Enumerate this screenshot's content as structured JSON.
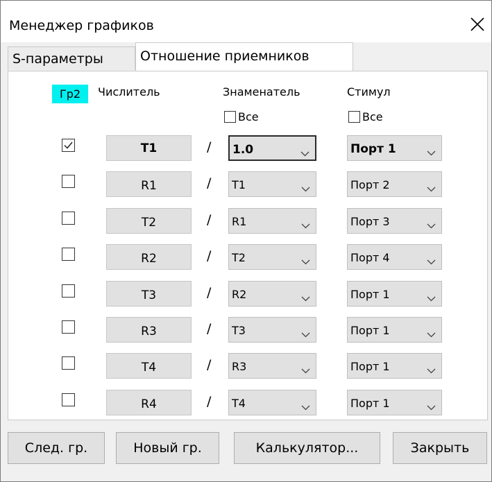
{
  "window": {
    "title": "Менеджер графиков",
    "close_icon": "close-icon"
  },
  "tabs": [
    {
      "label": "S-параметры",
      "active": false
    },
    {
      "label": "Отношение приемников",
      "active": true
    }
  ],
  "group_badge": {
    "label": "Гр2",
    "color": "#00f0f0"
  },
  "headers": {
    "numerator": "Числитель",
    "denominator": "Знаменатель",
    "stimulus": "Стимул",
    "all_den_label": "Все",
    "all_stim_label": "Все"
  },
  "slash": "/",
  "rows": [
    {
      "checked": true,
      "numerator": "T1",
      "denominator": "1.0",
      "stimulus": "Порт 1",
      "bold": true
    },
    {
      "checked": false,
      "numerator": "R1",
      "denominator": "T1",
      "stimulus": "Порт 2",
      "bold": false
    },
    {
      "checked": false,
      "numerator": "T2",
      "denominator": "R1",
      "stimulus": "Порт 3",
      "bold": false
    },
    {
      "checked": false,
      "numerator": "R2",
      "denominator": "T2",
      "stimulus": "Порт 4",
      "bold": false
    },
    {
      "checked": false,
      "numerator": "T3",
      "denominator": "R2",
      "stimulus": "Порт 1",
      "bold": false
    },
    {
      "checked": false,
      "numerator": "R3",
      "denominator": "T3",
      "stimulus": "Порт 1",
      "bold": false
    },
    {
      "checked": false,
      "numerator": "T4",
      "denominator": "R3",
      "stimulus": "Порт 1",
      "bold": false
    },
    {
      "checked": false,
      "numerator": "R4",
      "denominator": "T4",
      "stimulus": "Порт 1",
      "bold": false
    }
  ],
  "buttons": {
    "next_group": "След. гр.",
    "new_group": "Новый гр.",
    "calculator": "Калькулятор...",
    "close": "Закрыть"
  }
}
